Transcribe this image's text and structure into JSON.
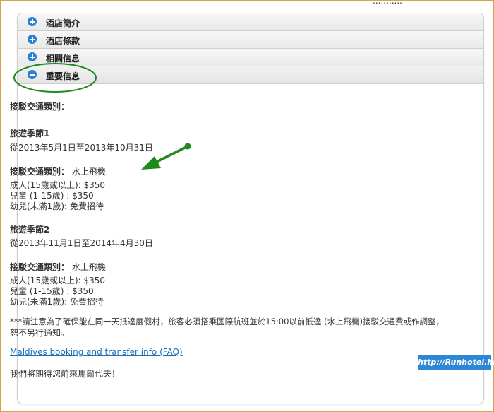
{
  "header_clip": "...........",
  "accordion": [
    {
      "label": "酒店簡介",
      "icon": "plus-circle-icon"
    },
    {
      "label": "酒店條款",
      "icon": "plus-circle-icon"
    },
    {
      "label": "相關信息",
      "icon": "plus-circle-icon"
    },
    {
      "label": "重要信息",
      "icon": "minus-circle-icon",
      "expanded": true
    }
  ],
  "content": {
    "transfer_type_heading": "接駁交通類別：",
    "season1": {
      "title": "旅遊季節1",
      "dates": "從2013年5月1日至2013年10月31日",
      "transfer_label": "接駁交通類別：",
      "transfer_value": "水上飛機",
      "adult": "成人(15歲或以上): $350",
      "child": "兒童 (1-15歲) : $350",
      "infant": "幼兒(未滿1歲): 免費招待"
    },
    "season2": {
      "title": "旅遊季節2",
      "dates": "從2013年11月1日至2014年4月30日",
      "transfer_label": "接駁交通類別：",
      "transfer_value": "水上飛機",
      "adult": "成人(15歲或以上): $350",
      "child": "兒童 (1-15歲) : $350",
      "infant": "幼兒(未滿1歲): 免費招待"
    },
    "notice_line1": "***請注意為了確保能在同一天抵達度假村，旅客必須搭乘國際航班並於15:00以前抵達 (水上飛機)接駁交通費或作調整，",
    "notice_line2": "恕不另行通知。",
    "faq_link": "Maldives booking and transfer info (FAQ)",
    "closing": "我們將期待您前來馬爾代夫！"
  },
  "watermark": "http://Runhotel.hk",
  "colors": {
    "frame": "#d6a24a",
    "accordion_icon": "#2a7fd1",
    "annotation_green": "#1e8a1e",
    "link": "#1a6fb5",
    "watermark_bg": "#2e86d6"
  }
}
